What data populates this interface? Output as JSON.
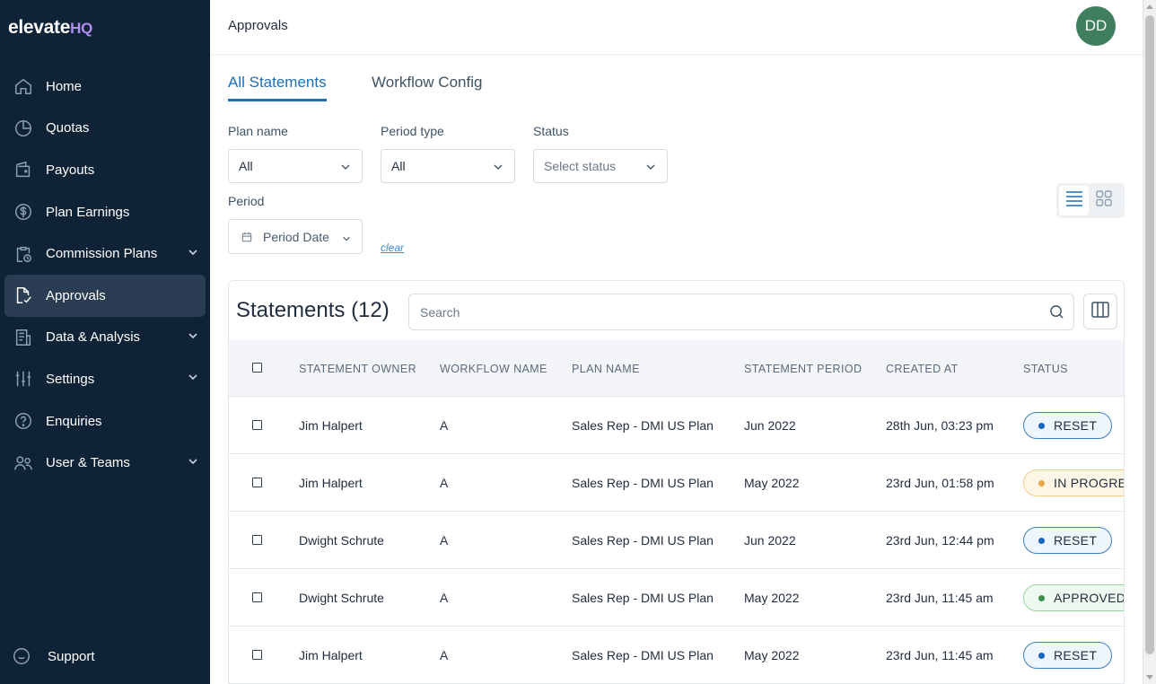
{
  "brand": {
    "name": "elevate",
    "suffix": "HQ"
  },
  "sidebar": {
    "items": [
      {
        "label": "Home",
        "icon": "home-icon",
        "chevron": false
      },
      {
        "label": "Quotas",
        "icon": "pie-chart-icon",
        "chevron": false
      },
      {
        "label": "Payouts",
        "icon": "wallet-icon",
        "chevron": false
      },
      {
        "label": "Plan Earnings",
        "icon": "dollar-circle-icon",
        "chevron": false
      },
      {
        "label": "Commission Plans",
        "icon": "clipboard-clock-icon",
        "chevron": true
      },
      {
        "label": "Approvals",
        "icon": "document-check-icon",
        "chevron": false,
        "active": true
      },
      {
        "label": "Data & Analysis",
        "icon": "report-icon",
        "chevron": true
      },
      {
        "label": "Settings",
        "icon": "sliders-icon",
        "chevron": true
      },
      {
        "label": "Enquiries",
        "icon": "help-circle-icon",
        "chevron": false
      },
      {
        "label": "User & Teams",
        "icon": "users-icon",
        "chevron": true
      }
    ],
    "support": "Support"
  },
  "header": {
    "title": "Approvals",
    "avatar_initials": "DD"
  },
  "tabs": [
    {
      "label": "All Statements",
      "active": true
    },
    {
      "label": "Workflow Config",
      "active": false
    }
  ],
  "filters": {
    "plan_name": {
      "label": "Plan name",
      "value": "All"
    },
    "period_type": {
      "label": "Period type",
      "value": "All"
    },
    "status": {
      "label": "Status",
      "placeholder": "Select status"
    },
    "period": {
      "label": "Period",
      "placeholder": "Period Date"
    },
    "clear": "clear"
  },
  "statements": {
    "title": "Statements (12)",
    "search_placeholder": "Search",
    "columns": [
      "STATEMENT OWNER",
      "WORKFLOW NAME",
      "PLAN NAME",
      "STATEMENT PERIOD",
      "CREATED AT",
      "STATUS"
    ],
    "rows": [
      {
        "owner": "Jim Halpert",
        "workflow": "A",
        "plan": "Sales Rep - DMI US Plan",
        "period": "Jun 2022",
        "created": "28th Jun, 03:23 pm",
        "status": "RESET"
      },
      {
        "owner": "Jim Halpert",
        "workflow": "A",
        "plan": "Sales Rep - DMI US Plan",
        "period": "May 2022",
        "created": "23rd Jun, 01:58 pm",
        "status": "IN PROGRESS"
      },
      {
        "owner": "Dwight Schrute",
        "workflow": "A",
        "plan": "Sales Rep - DMI US Plan",
        "period": "Jun 2022",
        "created": "23rd Jun, 12:44 pm",
        "status": "RESET"
      },
      {
        "owner": "Dwight Schrute",
        "workflow": "A",
        "plan": "Sales Rep - DMI US Plan",
        "period": "May 2022",
        "created": "23rd Jun, 11:45 am",
        "status": "APPROVED"
      },
      {
        "owner": "Jim Halpert",
        "workflow": "A",
        "plan": "Sales Rep - DMI US Plan",
        "period": "May 2022",
        "created": "23rd Jun, 11:45 am",
        "status": "RESET"
      }
    ]
  },
  "colors": {
    "sidebar_bg": "#0f2336",
    "accent": "#1c6fb8",
    "avatar": "#3f7e5e"
  }
}
